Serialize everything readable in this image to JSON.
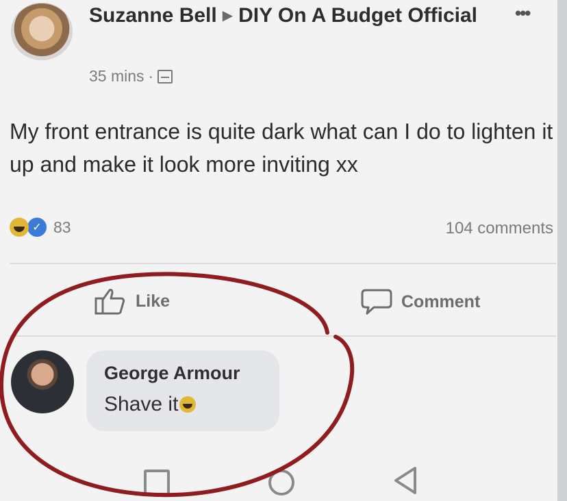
{
  "post": {
    "author": "Suzanne Bell",
    "group": "DIY On A Budget Official",
    "time": "35 mins",
    "separator": "·",
    "text": "My front entrance is quite dark what can I do to lighten it up and make it look more inviting xx",
    "reactions_count": "83",
    "comments_count": "104 comments"
  },
  "actions": {
    "like_label": "Like",
    "comment_label": "Comment"
  },
  "comment": {
    "author": "George Armour",
    "text": "Shave it"
  },
  "colors": {
    "annotation_circle": "#8f1d20",
    "like_reaction": "#3b7bd8",
    "haha_reaction": "#e2b737"
  },
  "icons": {
    "more": "more-icon",
    "privacy": "globe-icon",
    "like": "thumbs-up-icon",
    "comment": "speech-bubble-icon"
  }
}
